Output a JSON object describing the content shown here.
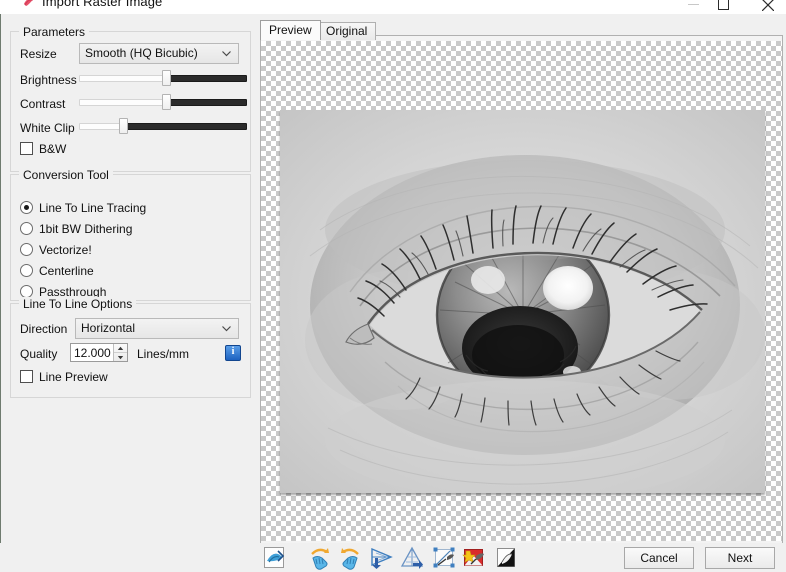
{
  "window": {
    "title": "Import Raster Image",
    "icon": "app-logo-icon",
    "controls": {
      "minimize": "—",
      "maximize": "☐",
      "close": "✕"
    }
  },
  "parameters": {
    "group_title": "Parameters",
    "resize_label": "Resize",
    "resize_value": "Smooth (HQ Bicubic)",
    "resize_options": [
      "Smooth (HQ Bicubic)"
    ],
    "brightness_label": "Brightness",
    "brightness_percent": 52,
    "contrast_label": "Contrast",
    "contrast_percent": 52,
    "white_clip_label": "White Clip",
    "white_clip_percent": 25,
    "bw_label": "B&W",
    "bw_checked": false
  },
  "conversion_tool": {
    "group_title": "Conversion Tool",
    "selected": "Line To Line Tracing",
    "options": [
      {
        "label": "Line To Line Tracing",
        "checked": true
      },
      {
        "label": "1bit BW Dithering",
        "checked": false
      },
      {
        "label": "Vectorize!",
        "checked": false
      },
      {
        "label": "Centerline",
        "checked": false
      },
      {
        "label": "Passthrough",
        "checked": false
      }
    ]
  },
  "line_options": {
    "group_title": "Line To Line Options",
    "direction_label": "Direction",
    "direction_value": "Horizontal",
    "direction_options": [
      "Horizontal"
    ],
    "quality_label": "Quality",
    "quality_value": "12.000",
    "quality_units": "Lines/mm",
    "info_glyph": "i",
    "line_preview_label": "Line Preview",
    "line_preview_checked": false
  },
  "preview": {
    "tabs": [
      {
        "label": "Preview",
        "active": true
      },
      {
        "label": "Original",
        "active": false
      }
    ],
    "image_description": "pencil sketch of a human eye"
  },
  "toolbar": {
    "buttons": [
      {
        "name": "reset-image",
        "title": "Reset Image"
      },
      {
        "name": "rotate-left",
        "title": "Rotate Left"
      },
      {
        "name": "rotate-right",
        "title": "Rotate Right"
      },
      {
        "name": "flip-horizontal",
        "title": "Flip Horizontal"
      },
      {
        "name": "flip-vertical",
        "title": "Flip Vertical"
      },
      {
        "name": "crop-tool",
        "title": "Crop"
      },
      {
        "name": "color-adjust",
        "title": "Color Adjust"
      },
      {
        "name": "invert-colors",
        "title": "Invert"
      }
    ]
  },
  "dialog_buttons": {
    "cancel": "Cancel",
    "next": "Next"
  },
  "colors": {
    "dialog_bg": "#f0f0f0",
    "slider_dark": "#2b2b2b",
    "info_blue": "#1d62c0",
    "accent_red": "#e8516a"
  }
}
